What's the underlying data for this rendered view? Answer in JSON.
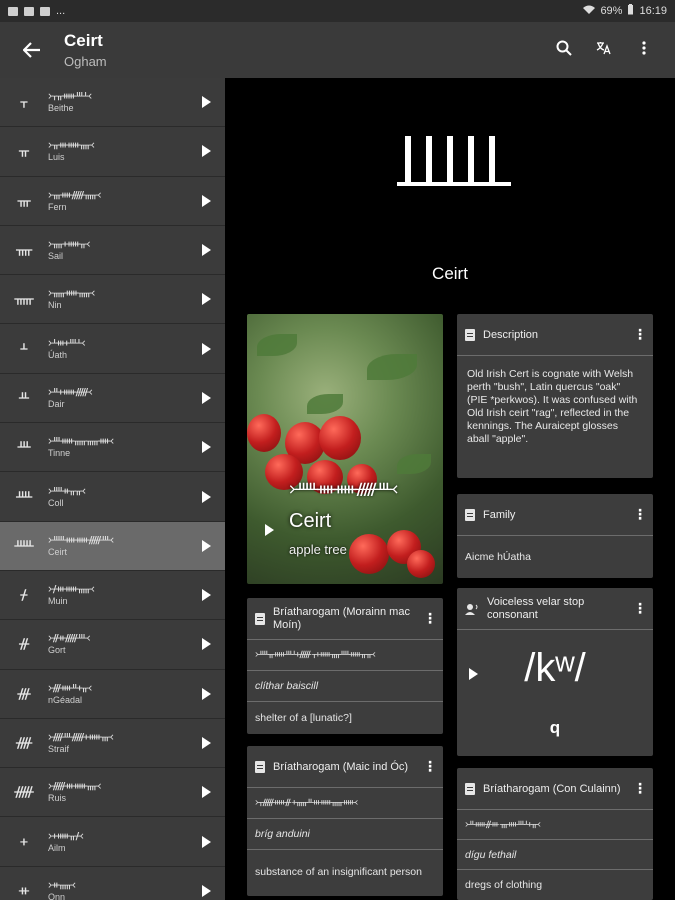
{
  "status_bar": {
    "left_dots": "...",
    "battery": "69%",
    "time": "16:19"
  },
  "appbar": {
    "back_icon": "arrow-left-icon",
    "title": "Ceirt",
    "subtitle": "Ogham",
    "actions": [
      "search-icon",
      "translate-icon",
      "more-vert-icon"
    ]
  },
  "letters": [
    {
      "glyph": "ᚁ",
      "ogham": "᚛ᚁᚂᚔᚈᚆ᚜",
      "name": "Beithe"
    },
    {
      "glyph": "ᚂ",
      "ogham": "᚛ᚂᚒᚔᚄ᚜",
      "name": "Luis"
    },
    {
      "glyph": "ᚃ",
      "ogham": "᚛ᚃᚓᚏᚅ᚜",
      "name": "Fern"
    },
    {
      "glyph": "ᚄ",
      "ogham": "᚛ᚄᚐᚔᚂ᚜",
      "name": "Sail"
    },
    {
      "glyph": "ᚅ",
      "ogham": "᚛ᚅᚔᚅ᚜",
      "name": "Nin"
    },
    {
      "glyph": "ᚆ",
      "ogham": "᚛ᚆᚒᚐᚈᚆ᚜",
      "name": "Úath"
    },
    {
      "glyph": "ᚇ",
      "ogham": "᚛ᚇᚐᚔᚏ᚜",
      "name": "Dair"
    },
    {
      "glyph": "ᚈ",
      "ogham": "᚛ᚈᚔᚅᚅᚓ᚜",
      "name": "Tinne"
    },
    {
      "glyph": "ᚉ",
      "ogham": "᚛ᚉᚑᚂᚂ᚜",
      "name": "Coll"
    },
    {
      "glyph": "ᚊ",
      "ogham": "᚛ᚊᚓᚔᚏᚈ᚜",
      "name": "Ceirt"
    },
    {
      "glyph": "ᚋ",
      "ogham": "᚛ᚋᚒᚔᚅ᚜",
      "name": "Muin"
    },
    {
      "glyph": "ᚌ",
      "ogham": "᚛ᚌᚑᚏᚈ᚜",
      "name": "Gort"
    },
    {
      "glyph": "ᚍ",
      "ogham": "᚛ᚍᚓᚇᚐᚂ᚜",
      "name": "nGéadal"
    },
    {
      "glyph": "ᚎ",
      "ogham": "᚛ᚎᚈᚏᚐᚔᚃ᚜",
      "name": "Straif"
    },
    {
      "glyph": "ᚏ",
      "ogham": "᚛ᚏᚒᚔᚄ᚜",
      "name": "Ruis"
    },
    {
      "glyph": "ᚐ",
      "ogham": "᚛ᚐᚔᚂᚋ᚜",
      "name": "Ailm"
    },
    {
      "glyph": "ᚑ",
      "ogham": "᚛ᚑᚅ᚜",
      "name": "Onn"
    }
  ],
  "selected_index": 9,
  "detail": {
    "heading": "Ceirt",
    "image_card": {
      "ogham": "᚛ᚊᚓᚔᚏᚈ᚜",
      "name": "Ceirt",
      "meaning": "apple tree"
    },
    "description": {
      "title": "Description",
      "text": "Old Irish Cert is cognate with Welsh perth \"bush\", Latin quercus \"oak\" (PIE *perkwos). It was confused with Old Irish ceirt \"rag\", reflected in the kennings. The Auraicept glosses aball \"apple\"."
    },
    "family": {
      "title": "Family",
      "value": "Aicme hÚatha"
    },
    "sound": {
      "title": "Voiceless velar stop consonant",
      "ipa": "/kʷ/",
      "latin": "q"
    },
    "kennings": [
      {
        "title": "Bríatharogam (Morainn mac Moín)",
        "ogham": "᚛ᚉᚂᚔᚈᚆᚐᚏ ᚁᚐᚔᚄᚉᚔᚂᚂ᚜",
        "irish": "clíthar baiscill",
        "english": "shelter of a [lunatic?]"
      },
      {
        "title": "Bríatharogam (Maic ind Óc)",
        "ogham": "᚛ᚁᚏᚔᚌ ᚐᚅᚇᚒᚔᚅᚔ᚜",
        "irish": "bríg anduini",
        "english": "substance of an insignificant person"
      },
      {
        "title": "Bríatharogam (Con Culainn)",
        "ogham": "᚛ᚇᚔᚌᚒ ᚃᚓᚈᚆᚐᚂ᚜",
        "irish": "dígu fethail",
        "english": "dregs of clothing"
      }
    ]
  }
}
